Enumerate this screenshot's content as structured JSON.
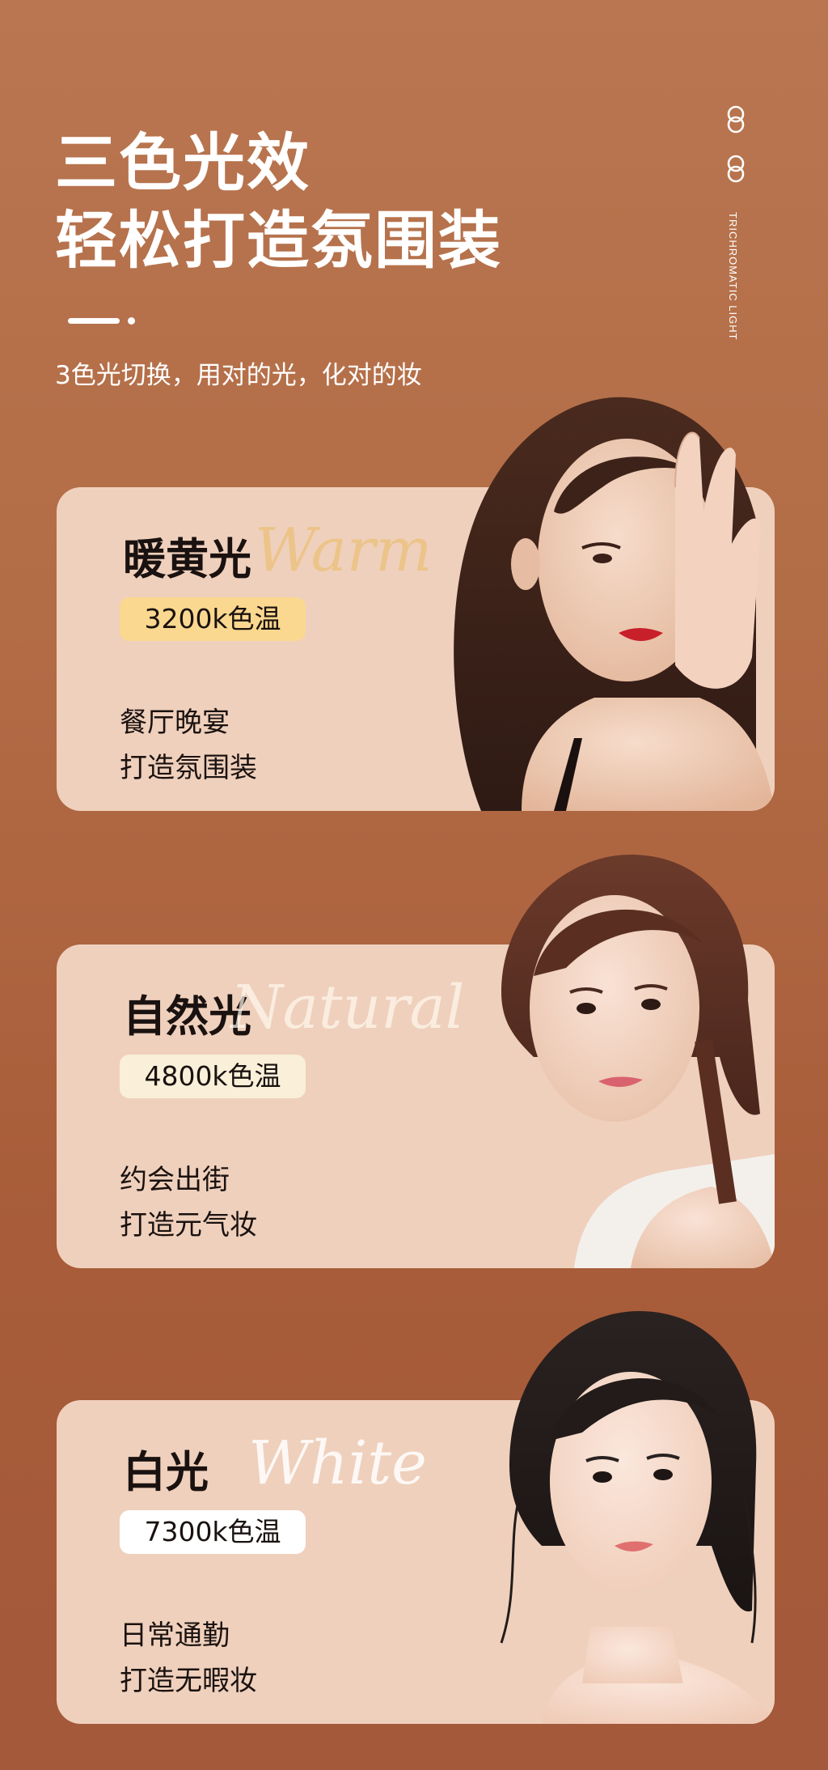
{
  "header": {
    "title_line1": "三色光效",
    "title_line2": "轻松打造氛围装",
    "subtitle": "3色光切换，用对的光，化对的妆",
    "side_label": "TRICHROMATIC LIGHT"
  },
  "modes": [
    {
      "name": "暖黄光",
      "script": "Warm",
      "temperature": "3200k色温",
      "line1": "餐厅晚宴",
      "line2": "打造氛围装",
      "badge_color": "#fbd88f"
    },
    {
      "name": "自然光",
      "script": "Natural",
      "temperature": "4800k色温",
      "line1": "约会出街",
      "line2": "打造元气妆",
      "badge_color": "#faefd9"
    },
    {
      "name": "白光",
      "script": "White",
      "temperature": "7300k色温",
      "line1": "日常通勤",
      "line2": "打造无暇妆",
      "badge_color": "#ffffff"
    }
  ],
  "colors": {
    "background": "#b26c46",
    "card": "#efd0bc",
    "text_dark": "#1a1210"
  }
}
